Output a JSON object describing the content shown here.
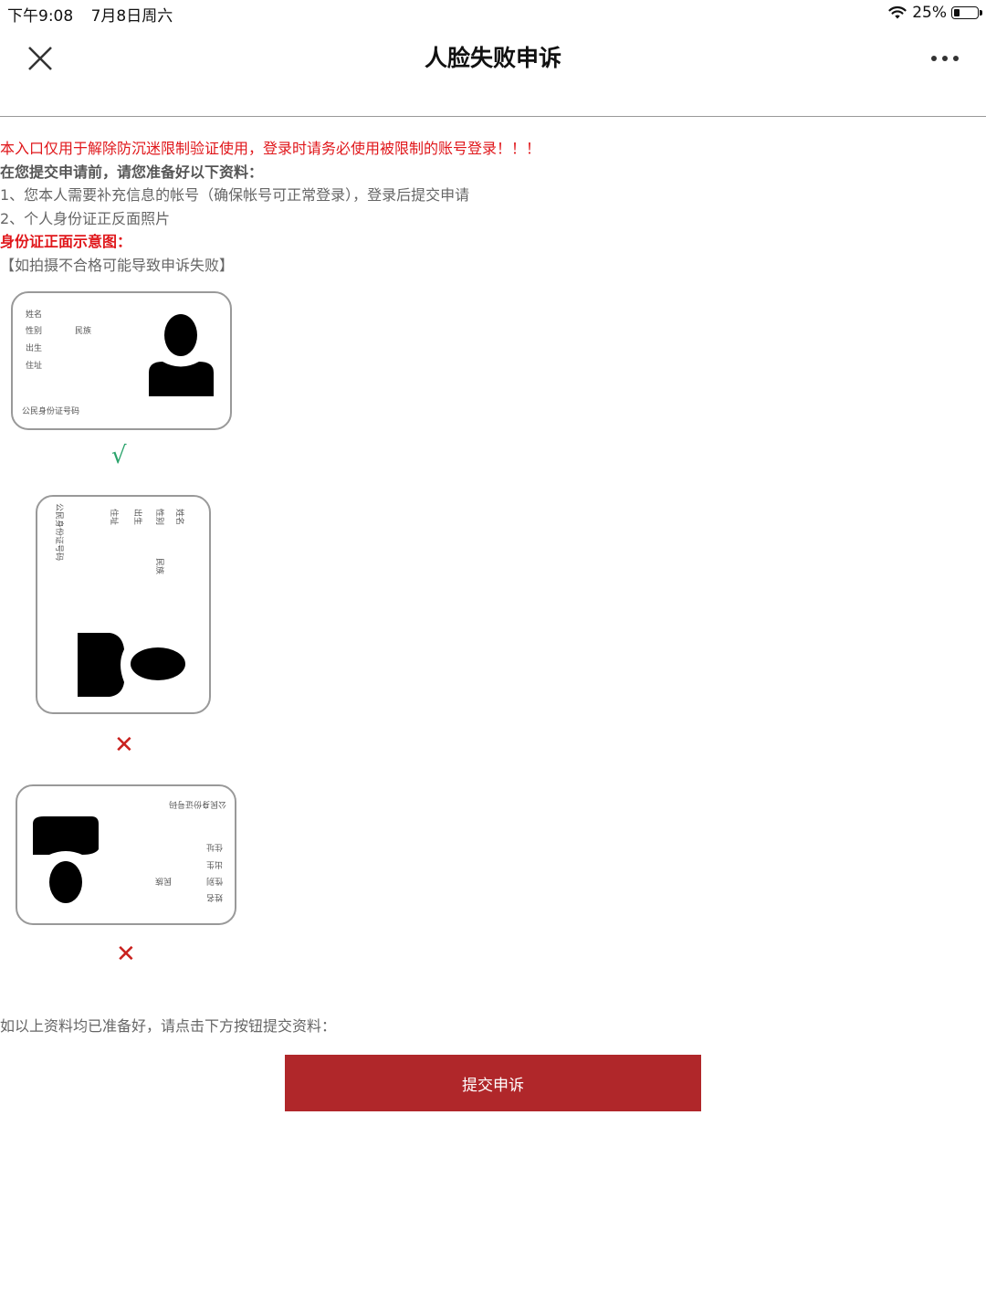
{
  "status_bar": {
    "time": "下午9:08",
    "date": "7月8日周六",
    "battery": "25%",
    "battery_level": 0.25
  },
  "header": {
    "title": "人脸失败申诉",
    "close_icon": "close-icon",
    "more_icon": "more-icon"
  },
  "intro": {
    "warning": "本入口仅用于解除防沉迷限制验证使用，登录时请务必使用被限制的账号登录！！！",
    "prep_heading": "在您提交申请前，请您准备好以下资料：",
    "item1": "1、您本人需要补充信息的帐号（确保帐号可正常登录），登录后提交申请",
    "item2": "2、个人身份证正反面照片",
    "sample_heading": "身份证正面示意图：",
    "note": "【如拍摄不合格可能导致申诉失败】"
  },
  "id_card": {
    "fields": [
      "姓名",
      "性别",
      "出生",
      "住址"
    ],
    "ethnicity": "民族",
    "id_number": "公民身份证号码"
  },
  "samples": [
    {
      "status": "correct",
      "mark": "√",
      "color": "#2aa36b"
    },
    {
      "status": "wrong",
      "mark": "✕",
      "color": "#c9211e"
    },
    {
      "status": "wrong",
      "mark": "✕",
      "color": "#c9211e"
    }
  ],
  "footer": {
    "instruction": "如以上资料均已准备好，请点击下方按钮提交资料：",
    "submit_label": "提交申诉",
    "button_color": "#b0272a"
  }
}
